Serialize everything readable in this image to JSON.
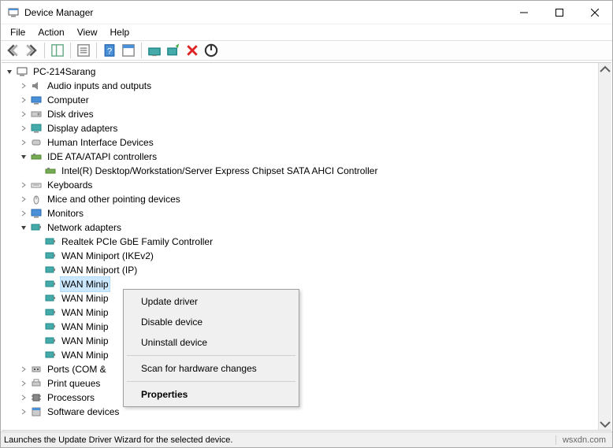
{
  "window": {
    "title": "Device Manager",
    "minimize_tooltip": "Minimize",
    "maximize_tooltip": "Maximize",
    "close_tooltip": "Close"
  },
  "menubar": {
    "items": [
      "File",
      "Action",
      "View",
      "Help"
    ]
  },
  "tree": {
    "root": "PC-214Sarang",
    "categories": [
      {
        "name": "Audio inputs and outputs",
        "expanded": false,
        "children": []
      },
      {
        "name": "Computer",
        "expanded": false,
        "children": []
      },
      {
        "name": "Disk drives",
        "expanded": false,
        "children": []
      },
      {
        "name": "Display adapters",
        "expanded": false,
        "children": []
      },
      {
        "name": "Human Interface Devices",
        "expanded": false,
        "children": []
      },
      {
        "name": "IDE ATA/ATAPI controllers",
        "expanded": true,
        "children": [
          "Intel(R) Desktop/Workstation/Server Express Chipset SATA AHCI Controller"
        ]
      },
      {
        "name": "Keyboards",
        "expanded": false,
        "children": []
      },
      {
        "name": "Mice and other pointing devices",
        "expanded": false,
        "children": []
      },
      {
        "name": "Monitors",
        "expanded": false,
        "children": []
      },
      {
        "name": "Network adapters",
        "expanded": true,
        "children": [
          "Realtek PCIe GbE Family Controller",
          "WAN Miniport (IKEv2)",
          "WAN Miniport (IP)",
          "WAN Minip",
          "WAN Minip",
          "WAN Minip",
          "WAN Minip",
          "WAN Minip",
          "WAN Minip"
        ],
        "selected_index": 3
      },
      {
        "name": "Ports (COM &",
        "expanded": false,
        "children": []
      },
      {
        "name": "Print queues",
        "expanded": false,
        "children": []
      },
      {
        "name": "Processors",
        "expanded": false,
        "children": []
      },
      {
        "name": "Software devices",
        "expanded": false,
        "children": []
      }
    ]
  },
  "context_menu": {
    "items": [
      {
        "label": "Update driver",
        "type": "item"
      },
      {
        "label": "Disable device",
        "type": "item"
      },
      {
        "label": "Uninstall device",
        "type": "item"
      },
      {
        "type": "sep"
      },
      {
        "label": "Scan for hardware changes",
        "type": "item"
      },
      {
        "type": "sep"
      },
      {
        "label": "Properties",
        "type": "item",
        "bold": true
      }
    ]
  },
  "statusbar": {
    "text": "Launches the Update Driver Wizard for the selected device.",
    "watermark": "wsxdn.com"
  }
}
